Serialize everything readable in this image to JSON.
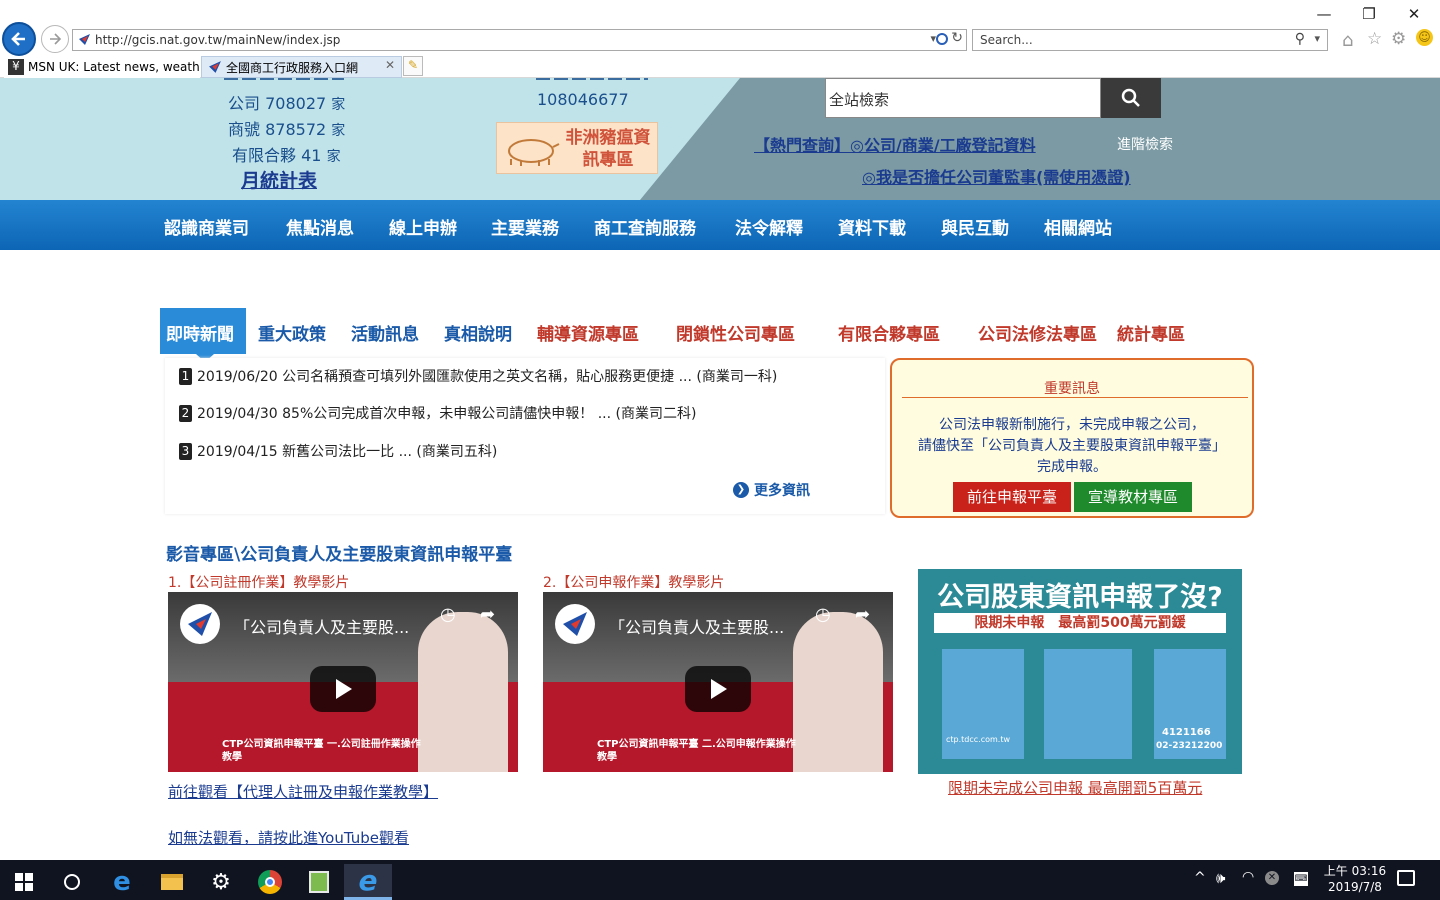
{
  "browser": {
    "url": "http://gcis.nat.gov.tw/mainNew/index.jsp",
    "search_placeholder": "Search...",
    "tabs": [
      {
        "label": "MSN UK: Latest news, weather,..."
      },
      {
        "label": "全國商工行政服務入口網"
      }
    ]
  },
  "header": {
    "stats": {
      "company": {
        "label": "公司",
        "value": "708027",
        "unit": "家"
      },
      "business": {
        "label": "商號",
        "value": "878572",
        "unit": "家"
      },
      "partnership": {
        "label": "有限合夥",
        "value": "41",
        "unit": "家"
      },
      "monthly_link": "月統計表",
      "counter": "108046677"
    },
    "banner_text": "非洲豬瘟資訊專區",
    "search_placeholder": "全站檢索",
    "hot_query_1": "【熱門查詢】◎公司/商業/工廠登記資料",
    "advanced_search": "進階檢索",
    "hot_query_2": "◎我是否擔任公司董監事(需使用憑證)"
  },
  "nav": {
    "items": [
      "認識商業司",
      "焦點消息",
      "線上申辦",
      "主要業務",
      "商工查詢服務",
      "法令解釋",
      "資料下載",
      "與民互動",
      "相關網站"
    ]
  },
  "content_tabs": {
    "active": "即時新聞",
    "blue": [
      "重大政策",
      "活動訊息",
      "真相說明"
    ],
    "red": [
      "輔導資源專區",
      "閉鎖性公司專區",
      "有限合夥專區",
      "公司法修法專區",
      "統計專區"
    ]
  },
  "news": {
    "items": [
      {
        "num": "1",
        "text": "2019/06/20 公司名稱預查可填列外國匯款使用之英文名稱，貼心服務更便捷 ... (商業司一科)"
      },
      {
        "num": "2",
        "text": "2019/04/30 85%公司完成首次申報，未申報公司請儘快申報！ ... (商業司二科)"
      },
      {
        "num": "3",
        "text": "2019/04/15 新舊公司法比一比 ... (商業司五科)"
      }
    ],
    "more": "更多資訊"
  },
  "notice": {
    "title": "重要訊息",
    "line1": "公司法申報新制施行，未完成申報之公司，",
    "line2": "請儘快至「公司負責人及主要股東資訊申報平臺」",
    "line3": "完成申報。",
    "btn1": "前往申報平臺",
    "btn2": "宣導教材專區"
  },
  "video_section": {
    "title": "影音專區\\公司負責人及主要股東資訊申報平臺",
    "video1_label": "1.【公司註冊作業】教學影片",
    "video2_label": "2.【公司申報作業】教學影片",
    "video_title": "「公司負責人及主要股...",
    "video1_caption": "CTP公司資訊申報平臺 一.公司註冊作業操作教學",
    "video2_caption": "CTP公司資訊申報平臺 二.公司申報作業操作教學",
    "agent_link": "前往觀看【代理人註冊及申報作業教學】",
    "youtube_link": "如無法觀看，請按此進YouTube觀看",
    "poster_title": "公司股東資訊申報了沒?",
    "poster_sub": "限期未申報　最高罰500萬元罰鍰",
    "poster_site": "ctp.tdcc.com.tw",
    "poster_phone1": "4121166",
    "poster_phone2": "02-23212200",
    "poster_link": "限期未完成公司申報 最高開罰5百萬元"
  },
  "taskbar": {
    "time": "上午 03:16",
    "date": "2019/7/8"
  }
}
